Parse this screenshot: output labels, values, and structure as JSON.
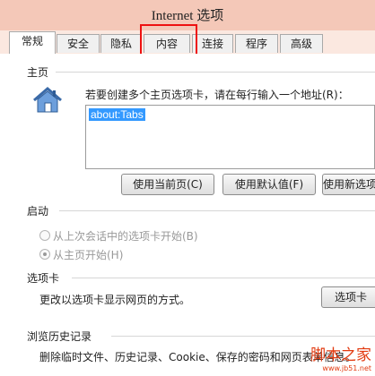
{
  "window": {
    "title": "Internet 选项"
  },
  "tabs": [
    {
      "label": "常规",
      "active": true
    },
    {
      "label": "安全"
    },
    {
      "label": "隐私"
    },
    {
      "label": "内容"
    },
    {
      "label": "连接"
    },
    {
      "label": "程序"
    },
    {
      "label": "高级"
    }
  ],
  "homepage": {
    "title": "主页",
    "instruction": "若要创建多个主页选项卡，请在每行输入一个地址(R)：",
    "url": "about:Tabs",
    "buttons": {
      "use_current": "使用当前页(C)",
      "use_default": "使用默认值(F)",
      "use_new_tab": "使用新选项卡"
    }
  },
  "startup": {
    "title": "启动",
    "option_last_session": "从上次会话中的选项卡开始(B)",
    "option_home": "从主页开始(H)"
  },
  "tabs_section": {
    "title": "选项卡",
    "description": "更改以选项卡显示网页的方式。",
    "button": "选项卡"
  },
  "history": {
    "title": "浏览历史记录",
    "description": "删除临时文件、历史记录、Cookie、保存的密码和网页表单信息。"
  },
  "watermark": {
    "main": "脚本之家",
    "sub": "www.jb51.net"
  },
  "colors": {
    "accent_highlight": "#e11111",
    "titlebar": "#f4c8b8",
    "selection": "#3399ff"
  }
}
